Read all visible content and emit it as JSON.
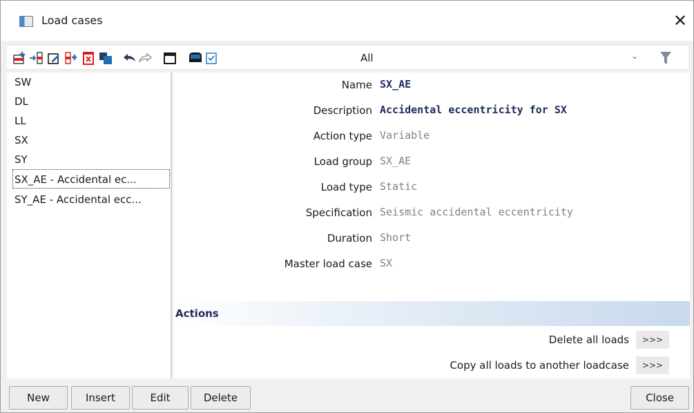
{
  "window": {
    "title": "Load cases",
    "close_glyph": "✕"
  },
  "toolbar": {
    "icons": [
      "new-icon",
      "insert-icon",
      "edit-icon",
      "copy-icon",
      "delete-icon",
      "duplicate-icon",
      "undo-icon",
      "redo-icon",
      "table-icon",
      "save-icon",
      "checklist-icon"
    ],
    "filter_value": "All",
    "filter_chevron": "⌄",
    "accent_color": "#1f6fb5",
    "delete_color": "#d92020",
    "filter_color": "#7d8a9a"
  },
  "list": {
    "items": [
      "SW",
      "DL",
      "LL",
      "SX",
      "SY",
      "SX_AE - Accidental ec...",
      "SY_AE - Accidental ecc..."
    ],
    "selected_index": 5
  },
  "properties": {
    "name_label": "Name",
    "name_value": "SX_AE",
    "description_label": "Description",
    "description_value": "Accidental eccentricity for SX",
    "action_type_label": "Action type",
    "action_type_value": "Variable",
    "load_group_label": "Load group",
    "load_group_value": "SX_AE",
    "load_type_label": "Load type",
    "load_type_value": "Static",
    "specification_label": "Specification",
    "specification_value": "Seismic accidental eccentricity",
    "duration_label": "Duration",
    "duration_value": "Short",
    "master_label": "Master load case",
    "master_value": "SX"
  },
  "actions": {
    "title": "Actions",
    "delete_all_label": "Delete all loads",
    "delete_all_btn": ">>>",
    "copy_all_label": "Copy all loads to another loadcase",
    "copy_all_btn": ">>>"
  },
  "buttons": {
    "new": "New",
    "insert": "Insert",
    "edit": "Edit",
    "delete": "Delete",
    "close": "Close"
  }
}
